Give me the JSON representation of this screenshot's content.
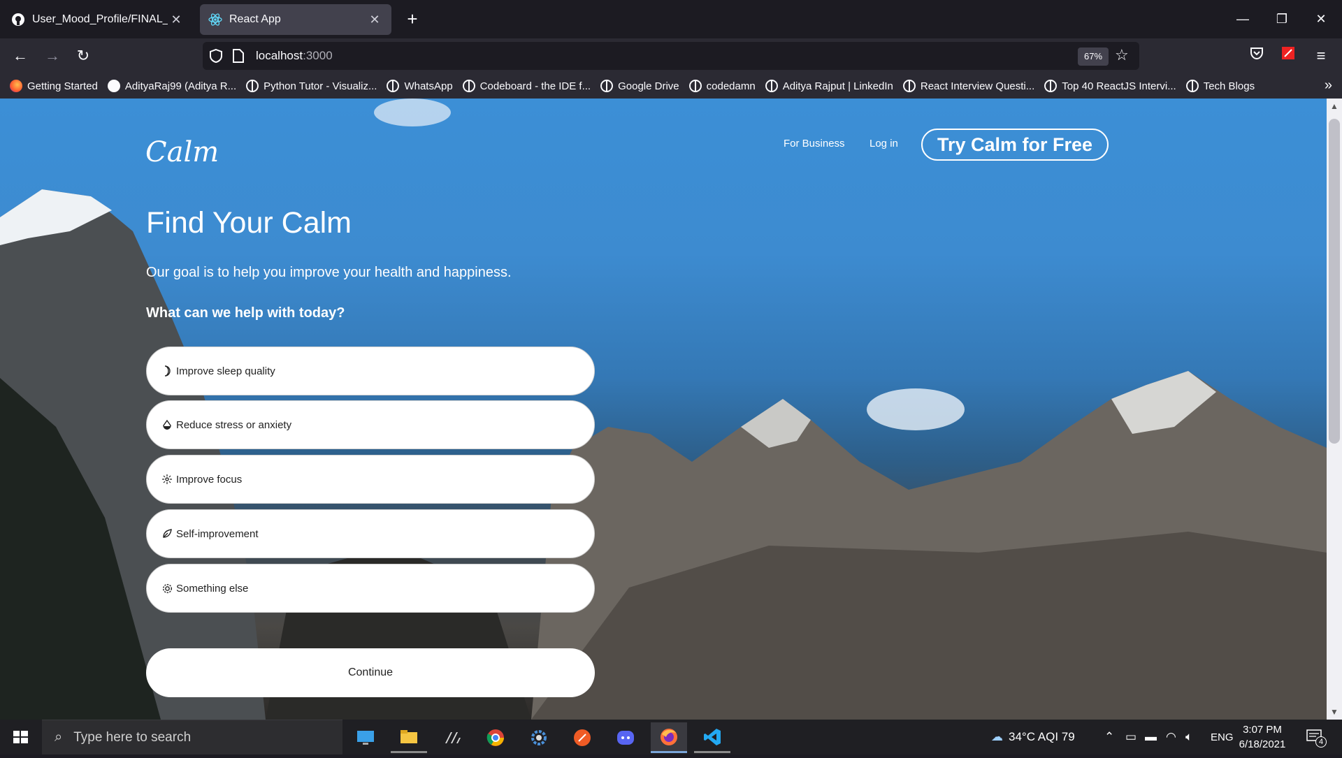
{
  "browser": {
    "tabs": [
      {
        "title": "User_Mood_Profile/FINAL_UI at",
        "icon": "github-icon",
        "active": false
      },
      {
        "title": "React App",
        "icon": "react-icon",
        "active": true
      }
    ],
    "url_host": "localhost",
    "url_port": ":3000",
    "zoom": "67%",
    "bookmarks": [
      "Getting Started",
      "AdityaRaj99 (Aditya R...",
      "Python Tutor - Visualiz...",
      "WhatsApp",
      "Codeboard - the IDE f...",
      "Google Drive",
      "codedamn",
      "Aditya Rajput | LinkedIn",
      "React Interview Questi...",
      "Top 40 ReactJS Intervi...",
      "Tech Blogs"
    ]
  },
  "page": {
    "logo": "Calm",
    "nav": {
      "for_business": "For Business",
      "login": "Log in",
      "try_free": "Try Calm for Free"
    },
    "heading": "Find Your Calm",
    "subheading": "Our goal is to help you improve your health and happiness.",
    "question": "What can we help with today?",
    "options": [
      {
        "label": "Improve sleep quality",
        "icon": "moon-icon"
      },
      {
        "label": "Reduce stress or anxiety",
        "icon": "drop-icon"
      },
      {
        "label": "Improve focus",
        "icon": "focus-icon"
      },
      {
        "label": "Self-improvement",
        "icon": "leaf-icon"
      },
      {
        "label": "Something else",
        "icon": "gear-icon"
      }
    ],
    "continue": "Continue"
  },
  "taskbar": {
    "search_placeholder": "Type here to search",
    "weather": "34°C  AQI 79",
    "language": "ENG",
    "time": "3:07 PM",
    "date": "6/18/2021",
    "notifications": "4"
  }
}
